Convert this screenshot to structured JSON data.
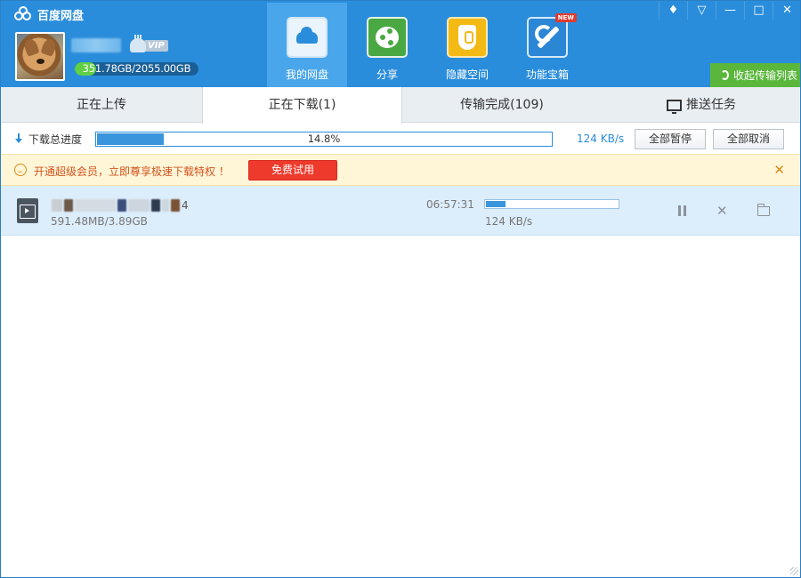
{
  "app": {
    "title": "百度网盘"
  },
  "user": {
    "vip_label": "VIP",
    "quota_text": "351.78GB/2055.00GB",
    "quota_used_fraction": 0.171
  },
  "nav": [
    {
      "label": "我的网盘",
      "icon": "cloud-disk-icon",
      "active": true
    },
    {
      "label": "分享",
      "icon": "share-icon"
    },
    {
      "label": "隐藏空间",
      "icon": "lock-icon"
    },
    {
      "label": "功能宝箱",
      "icon": "tools-icon",
      "badge": "NEW"
    }
  ],
  "window_controls": {
    "notify": "bell-icon",
    "menu": "menu-icon",
    "minimize": "minimize-icon",
    "maximize": "maximize-icon",
    "close": "close-icon"
  },
  "collapse_label": "收起传输列表",
  "tabs": [
    {
      "label": "正在上传"
    },
    {
      "label": "正在下载(1)",
      "active": true
    },
    {
      "label": "传输完成(109)"
    },
    {
      "label": "推送任务"
    }
  ],
  "progress": {
    "label": "下载总进度",
    "percent_text": "14.8%",
    "fraction": 0.148,
    "speed": "124 KB/s",
    "pause_all": "全部暂停",
    "cancel_all": "全部取消"
  },
  "banner": {
    "text": "开通超级会员，立即尊享极速下载特权 ！",
    "trial_button": "免费试用"
  },
  "download_item": {
    "name_suffix": "4",
    "size": "591.48MB/3.89GB",
    "time_left": "06:57:31",
    "fraction": 0.148,
    "speed": "124 KB/s"
  },
  "colors": {
    "header_bg": "#2a8ddb",
    "nav_active_bg": "#4aa6ea",
    "accent_green": "#5ab73c",
    "trial_red": "#ee3a2c",
    "row_highlight": "#dcedfb"
  }
}
